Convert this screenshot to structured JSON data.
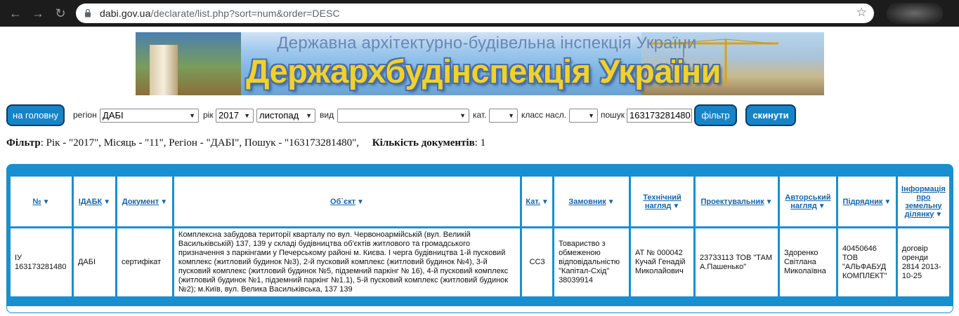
{
  "browser": {
    "url_domain": "dabi.gov.ua",
    "url_path": "/declarate/list.php?sort=num&order=DESC"
  },
  "banner": {
    "subtitle": "Державна архітектурно-будівельна інспекція України",
    "title": "Держархбудінспекція України"
  },
  "filters": {
    "home_button": "на головну",
    "region_label": "регіон",
    "region_value": "ДАБІ",
    "year_label": "рік",
    "year_value": "2017",
    "month_value": "листопад",
    "type_label": "вид",
    "type_value": "",
    "cat_label": "кат.",
    "cat_value": "",
    "class_label": "класс насл.",
    "class_value": "",
    "search_label": "пошук",
    "search_value": "163173281480",
    "filter_button": "фільтр",
    "reset_button": "скинути"
  },
  "summary": {
    "filter_label": "Фільтр",
    "filter_text": ": Рік - \"2017\", Місяць - \"11\", Регіон - \"ДАБІ\", Пошук - \"163173281480\",",
    "count_label": "Кількість документів",
    "count_text": ": 1"
  },
  "table": {
    "headers": {
      "num": "№",
      "idabk": "ІДАБК",
      "doc": "Документ",
      "object": "Об`єкт",
      "cat": "Кат.",
      "customer": "Замовник",
      "tech_l1": "Технічний",
      "tech_l2": "нагляд",
      "designer": "Проектувальник",
      "author_l1": "Авторський",
      "author_l2": "нагляд",
      "contractor": "Підрядник",
      "land_l1": "Інформація",
      "land_l2": "про",
      "land_l3": "земельну",
      "land_l4": "ділянку"
    },
    "row": {
      "num": "ІУ 163173281480",
      "idabk": "ДАБІ",
      "doc": "сертифікат",
      "object": "Комплексна забудова території кварталу по вул. Червоноармійській (вул. Великій Васильківській) 137, 139 у складі будівництва об'єктів житлового та громадського призначення з паркінгами у Печерському районі м. Києва. І черга будівництва 1-й пусковий комплекс (житловий будинок №3), 2-й пусковий комплекс (житловий будинок №4), 3-й пусковий комплекс (житловий будинок №5, підземний паркінг № 16), 4-й пусковий комплекс (житловий будинок №1, підземний паркінг №1.1), 5-й пусковий комплекс (житловий будинок №2); м.Київ, вул. Велика Васильківська, 137 139",
      "cat": "СС3",
      "customer": "Товариство з обмеженою відповідальністю \"Капітал-Схід\" 38039914",
      "tech": "АТ № 000042 Кучай Генадій Миколайович",
      "designer": "23733113 ТОВ \"ТАМ А.Пашенько\"",
      "author": "Здоренко Світлана Миколаївна",
      "contractor": "40450646 ТОВ \"АЛЬФАБУД КОМПЛЕКТ\"",
      "land": "договір оренди 2814 2013-10-25"
    }
  }
}
